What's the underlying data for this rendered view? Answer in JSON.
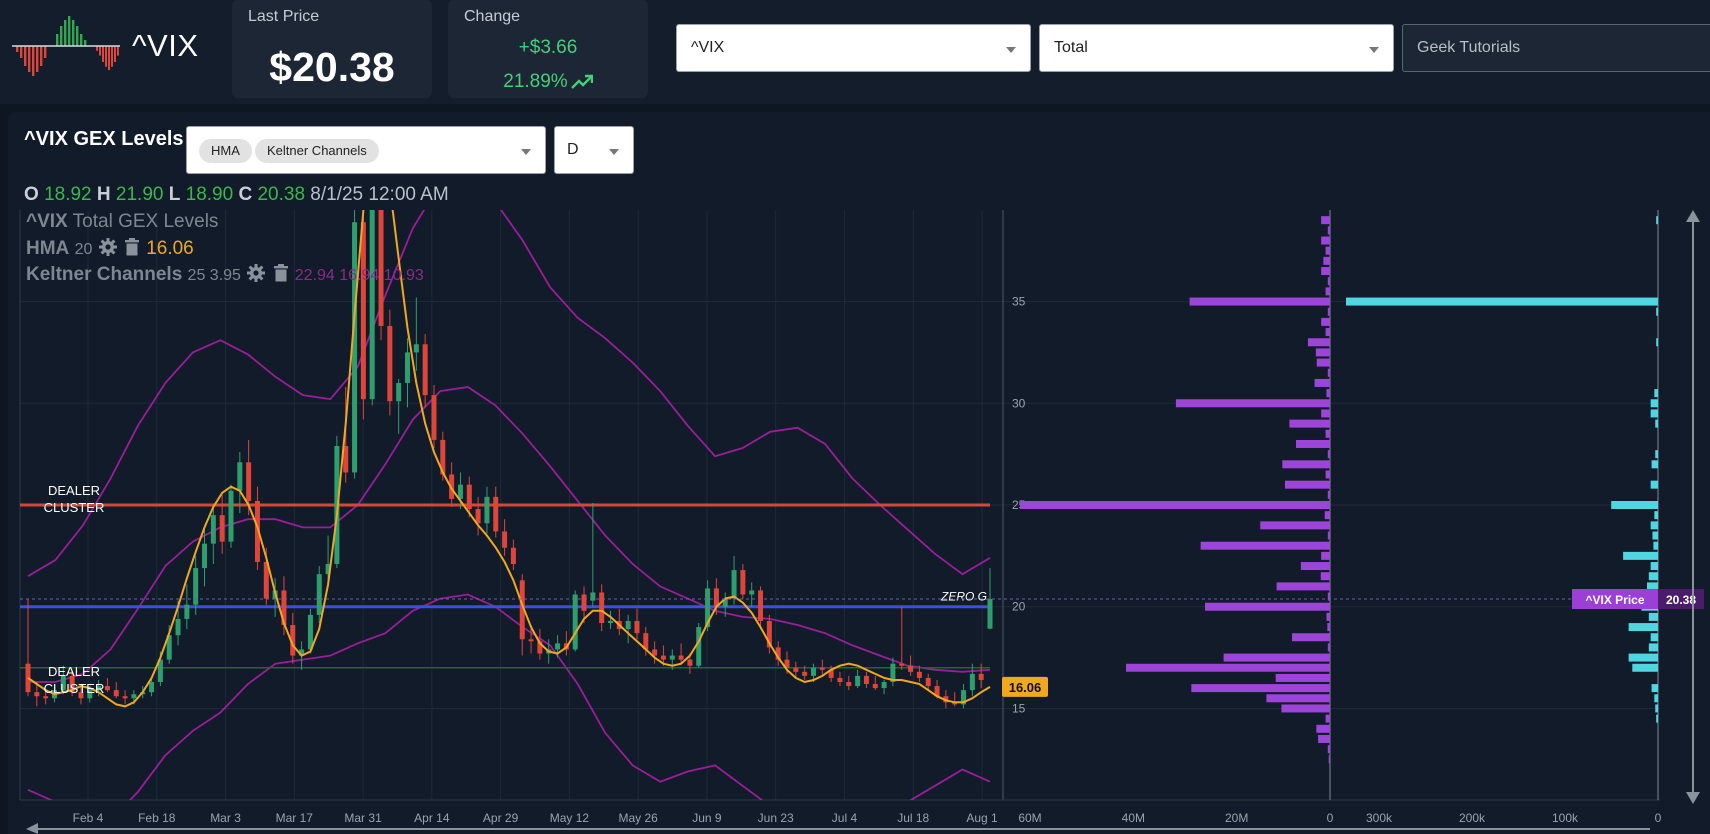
{
  "header": {
    "symbol": "^VIX",
    "last_price_label": "Last Price",
    "last_price": "$20.38",
    "change_label": "Change",
    "change_abs": "+$3.66",
    "change_pct": "21.89%",
    "symbol_select": "^VIX",
    "type_select": "Total",
    "tutorial_select": "Geek Tutorials"
  },
  "panel": {
    "title": "^VIX GEX Levels",
    "indicators": [
      "HMA",
      "Keltner Channels"
    ],
    "timeframe": "D"
  },
  "ohlc": {
    "o_label": "O",
    "o": "18.92",
    "h_label": "H",
    "h": "21.90",
    "l_label": "L",
    "l": "18.90",
    "c_label": "C",
    "c": "20.38",
    "datetime": "8/1/25 12:00 AM"
  },
  "legend": {
    "series_symbol": "^VIX",
    "series_name": "Total GEX Levels",
    "hma_name": "HMA",
    "hma_param": "20",
    "hma_value": "16.06",
    "kc_name": "Keltner Channels",
    "kc_param": "25 3.95",
    "kc_values": "22.94 16.94 10.93"
  },
  "colors": {
    "up": "#2e9e6e",
    "down": "#e0453a",
    "hma": "#f0a820",
    "keltner": "#9a1e9a",
    "dealer_line": "#d6473a",
    "zero_g_line": "#3b4fe0",
    "gex_call": "#9c45d8",
    "gex_put": "#4fd6e0",
    "price_badge": "#9c3fd6"
  },
  "chart_data": {
    "type": "candlestick",
    "x_tick_labels": [
      "Feb 4",
      "Feb 18",
      "Mar 3",
      "Mar 17",
      "Mar 31",
      "Apr 14",
      "Apr 29",
      "May 12",
      "May 26",
      "Jun 9",
      "Jun 23",
      "Jul 4",
      "Jul 18",
      "Aug 1"
    ],
    "y_ticks": [
      15,
      20,
      25,
      30,
      35
    ],
    "ylim": [
      10.5,
      39.5
    ],
    "candles": [
      [
        17.2,
        20.4,
        15.6,
        15.8
      ],
      [
        15.8,
        16.3,
        15.1,
        15.6
      ],
      [
        15.6,
        15.9,
        15.2,
        15.5
      ],
      [
        15.5,
        16.2,
        15.3,
        15.9
      ],
      [
        15.9,
        17.1,
        15.7,
        16.6
      ],
      [
        16.6,
        16.9,
        15.6,
        15.8
      ],
      [
        15.8,
        16.1,
        15.2,
        15.5
      ],
      [
        15.5,
        16.1,
        15.3,
        15.9
      ],
      [
        15.9,
        16.4,
        15.6,
        16.1
      ],
      [
        16.1,
        16.5,
        15.8,
        15.9
      ],
      [
        15.9,
        16.3,
        15.5,
        15.6
      ],
      [
        15.6,
        15.9,
        15.2,
        15.5
      ],
      [
        15.5,
        15.9,
        15.2,
        15.7
      ],
      [
        15.7,
        16.1,
        15.5,
        15.8
      ],
      [
        15.8,
        16.5,
        15.6,
        16.3
      ],
      [
        16.3,
        17.8,
        16.1,
        17.4
      ],
      [
        17.4,
        19.1,
        17.2,
        18.6
      ],
      [
        18.6,
        20.3,
        18.1,
        19.4
      ],
      [
        19.4,
        21.1,
        18.9,
        20.1
      ],
      [
        20.1,
        22.5,
        19.6,
        21.9
      ],
      [
        21.9,
        23.8,
        21.0,
        23.1
      ],
      [
        23.1,
        24.9,
        22.1,
        24.5
      ],
      [
        24.5,
        25.5,
        22.6,
        23.2
      ],
      [
        23.2,
        26.0,
        22.9,
        25.7
      ],
      [
        25.7,
        27.6,
        24.6,
        27.1
      ],
      [
        27.1,
        28.2,
        24.5,
        25.2
      ],
      [
        25.2,
        25.9,
        21.8,
        22.2
      ],
      [
        22.2,
        22.9,
        20.1,
        20.4
      ],
      [
        20.4,
        21.4,
        19.5,
        20.8
      ],
      [
        20.8,
        21.5,
        18.6,
        19.1
      ],
      [
        19.1,
        19.7,
        17.2,
        17.6
      ],
      [
        17.6,
        18.3,
        16.9,
        17.9
      ],
      [
        17.9,
        19.9,
        17.7,
        19.6
      ],
      [
        19.6,
        22.0,
        19.2,
        21.6
      ],
      [
        21.6,
        23.5,
        21.0,
        22.1
      ],
      [
        22.1,
        28.4,
        21.9,
        27.9
      ],
      [
        27.9,
        30.8,
        26.1,
        26.6
      ],
      [
        26.6,
        40.0,
        26.3,
        38.9
      ],
      [
        38.9,
        44.5,
        29.2,
        30.2
      ],
      [
        30.2,
        52.3,
        29.9,
        45.3
      ],
      [
        45.3,
        46.1,
        33.1,
        33.8
      ],
      [
        33.8,
        34.6,
        29.4,
        30.1
      ],
      [
        30.1,
        31.2,
        28.5,
        31.0
      ],
      [
        31.0,
        33.2,
        29.8,
        32.5
      ],
      [
        32.5,
        35.2,
        31.6,
        32.9
      ],
      [
        32.9,
        33.4,
        29.8,
        30.4
      ],
      [
        30.4,
        30.9,
        27.8,
        28.2
      ],
      [
        28.2,
        28.6,
        26.2,
        26.5
      ],
      [
        26.5,
        27.1,
        24.9,
        25.3
      ],
      [
        25.3,
        26.6,
        24.8,
        26.0
      ],
      [
        26.0,
        26.4,
        24.4,
        24.8
      ],
      [
        24.8,
        25.4,
        23.5,
        24.1
      ],
      [
        24.1,
        25.9,
        23.6,
        25.4
      ],
      [
        25.4,
        25.9,
        23.4,
        23.7
      ],
      [
        23.7,
        24.3,
        22.5,
        22.9
      ],
      [
        22.9,
        23.3,
        21.8,
        22.1
      ],
      [
        21.3,
        21.6,
        17.6,
        18.4
      ],
      [
        18.4,
        19.1,
        17.7,
        18.3
      ],
      [
        18.3,
        18.9,
        17.4,
        17.7
      ],
      [
        17.7,
        18.4,
        17.2,
        17.9
      ],
      [
        17.9,
        18.6,
        17.5,
        18.2
      ],
      [
        18.2,
        18.8,
        17.6,
        17.9
      ],
      [
        17.9,
        20.8,
        17.8,
        20.6
      ],
      [
        20.6,
        21.0,
        19.2,
        19.8
      ],
      [
        20.3,
        25.1,
        20.0,
        20.7
      ],
      [
        20.7,
        21.1,
        18.8,
        19.2
      ],
      [
        19.2,
        19.8,
        18.9,
        19.3
      ],
      [
        19.3,
        19.9,
        18.6,
        18.9
      ],
      [
        18.9,
        19.6,
        18.2,
        19.3
      ],
      [
        19.3,
        19.9,
        18.4,
        18.7
      ],
      [
        18.7,
        19.0,
        17.6,
        17.9
      ],
      [
        17.9,
        18.3,
        17.2,
        17.6
      ],
      [
        17.6,
        18.1,
        17.1,
        17.4
      ],
      [
        17.4,
        17.9,
        16.9,
        17.6
      ],
      [
        17.6,
        18.2,
        17.2,
        17.4
      ],
      [
        17.4,
        17.7,
        16.7,
        17.1
      ],
      [
        17.1,
        19.2,
        17.0,
        19.0
      ],
      [
        19.0,
        21.3,
        18.8,
        20.9
      ],
      [
        20.9,
        21.4,
        19.6,
        20.0
      ],
      [
        20.0,
        20.7,
        19.5,
        20.4
      ],
      [
        20.4,
        22.5,
        20.1,
        21.8
      ],
      [
        21.8,
        22.1,
        20.4,
        20.6
      ],
      [
        20.6,
        21.2,
        20.0,
        20.8
      ],
      [
        20.8,
        21.0,
        18.9,
        19.3
      ],
      [
        19.3,
        19.6,
        17.7,
        18.0
      ],
      [
        18.0,
        18.3,
        17.1,
        17.4
      ],
      [
        17.4,
        17.8,
        16.7,
        17.0
      ],
      [
        17.0,
        17.3,
        16.5,
        16.8
      ],
      [
        16.8,
        17.1,
        16.4,
        16.6
      ],
      [
        16.6,
        17.2,
        16.3,
        17.0
      ],
      [
        17.0,
        17.4,
        16.6,
        16.9
      ],
      [
        16.9,
        17.1,
        16.3,
        16.5
      ],
      [
        16.5,
        16.8,
        16.1,
        16.3
      ],
      [
        16.3,
        16.6,
        15.9,
        16.1
      ],
      [
        16.1,
        16.9,
        16.0,
        16.6
      ],
      [
        16.6,
        16.8,
        16.0,
        16.2
      ],
      [
        16.2,
        16.6,
        15.9,
        16.0
      ],
      [
        16.0,
        16.4,
        15.7,
        16.3
      ],
      [
        16.3,
        17.5,
        16.1,
        17.2
      ],
      [
        17.2,
        20.0,
        16.9,
        17.1
      ],
      [
        17.1,
        17.6,
        16.6,
        16.8
      ],
      [
        16.8,
        17.1,
        16.3,
        16.5
      ],
      [
        16.5,
        16.7,
        15.9,
        16.1
      ],
      [
        16.1,
        16.4,
        15.5,
        15.6
      ],
      [
        15.6,
        15.9,
        15.0,
        15.3
      ],
      [
        15.3,
        15.8,
        15.1,
        15.2
      ],
      [
        15.2,
        16.2,
        15.0,
        15.9
      ],
      [
        15.9,
        17.2,
        15.6,
        16.7
      ],
      [
        16.7,
        17.2,
        16.0,
        16.4
      ],
      [
        18.92,
        21.9,
        18.9,
        20.38
      ]
    ],
    "hma": [
      16.5,
      16.2,
      15.9,
      15.7,
      15.8,
      15.9,
      16.1,
      16.0,
      15.8,
      15.5,
      15.2,
      15.1,
      15.3,
      15.8,
      16.5,
      17.5,
      18.7,
      20.0,
      21.4,
      22.7,
      23.9,
      24.9,
      25.6,
      25.9,
      25.7,
      25.0,
      23.9,
      22.4,
      20.7,
      19.2,
      18.1,
      17.6,
      17.8,
      18.9,
      21.1,
      24.5,
      29.0,
      34.4,
      39.5,
      42.9,
      43.1,
      40.6,
      37.1,
      33.7,
      31.0,
      29.0,
      27.6,
      26.6,
      25.8,
      25.2,
      24.6,
      24.0,
      23.5,
      22.9,
      22.2,
      21.3,
      20.1,
      19.0,
      18.2,
      17.8,
      17.7,
      18.0,
      18.7,
      19.4,
      19.8,
      19.8,
      19.5,
      19.1,
      18.7,
      18.3,
      17.9,
      17.5,
      17.2,
      17.1,
      17.2,
      17.6,
      18.3,
      19.2,
      20.0,
      20.4,
      20.5,
      20.2,
      19.7,
      19.0,
      18.2,
      17.5,
      16.9,
      16.5,
      16.3,
      16.4,
      16.6,
      16.9,
      17.1,
      17.2,
      17.1,
      16.9,
      16.7,
      16.5,
      16.4,
      16.4,
      16.3,
      16.2,
      15.9,
      15.6,
      15.4,
      15.3,
      15.3,
      15.5,
      15.8,
      16.06
    ],
    "keltner_upper": [
      21.5,
      22.3,
      24.0,
      26.3,
      28.9,
      31.0,
      32.5,
      33.1,
      32.4,
      31.3,
      30.4,
      30.2,
      31.8,
      35.3,
      38.6,
      40.8,
      41.0,
      39.9,
      38.0,
      35.7,
      34.2,
      33.2,
      32.0,
      30.6,
      28.9,
      27.4,
      27.8,
      28.6,
      28.8,
      28.0,
      26.3,
      25.0,
      23.8,
      22.6,
      21.6,
      22.4
    ],
    "keltner_mid": [
      16.3,
      16.3,
      16.7,
      17.9,
      19.9,
      22.0,
      23.2,
      23.9,
      24.3,
      24.3,
      23.9,
      23.9,
      25.0,
      27.0,
      29.2,
      30.6,
      30.8,
      29.9,
      28.5,
      26.9,
      25.2,
      23.5,
      22.1,
      21.0,
      20.4,
      19.8,
      19.5,
      19.4,
      19.1,
      18.7,
      18.1,
      17.6,
      17.1,
      16.9,
      16.8,
      16.9
    ],
    "keltner_lower": [
      11.0,
      10.4,
      9.4,
      9.5,
      10.9,
      12.7,
      13.9,
      14.8,
      16.2,
      17.2,
      17.4,
      17.6,
      18.2,
      18.7,
      19.8,
      20.4,
      20.6,
      20.0,
      19.0,
      18.1,
      16.2,
      13.8,
      12.2,
      11.4,
      11.9,
      12.2,
      11.2,
      10.2,
      9.4,
      9.4,
      10.0,
      10.2,
      10.4,
      11.2,
      12.0,
      11.4
    ],
    "levels": [
      {
        "label": "DEALER CLUSTER",
        "value": 25,
        "color": "#d6473a"
      },
      {
        "label": "ZERO G",
        "value": 20,
        "color": "#3b4fe0"
      },
      {
        "label": "DEALER CLUSTER",
        "value": 17,
        "color": "#1f6a2a"
      }
    ],
    "hma_badge": "16.06",
    "price_badge_label": "^VIX Price",
    "price_badge_value": "20.38",
    "gex_left_ticks": [
      "60M",
      "40M",
      "20M",
      "0"
    ],
    "gex_right_ticks": [
      "300k",
      "200k",
      "100k",
      "0"
    ],
    "gex_levels": [
      39,
      38.5,
      38,
      37.5,
      37,
      36.5,
      36,
      35.5,
      35,
      34.5,
      34,
      33.5,
      33,
      32.5,
      32,
      31.5,
      31,
      30.5,
      30,
      29.5,
      29,
      28.5,
      28,
      27.5,
      27,
      26.5,
      26,
      25.5,
      25,
      24.5,
      24,
      23.5,
      23,
      22.5,
      22,
      21.5,
      21,
      20.5,
      20,
      19.5,
      19,
      18.5,
      18,
      17.5,
      17,
      16.5,
      16,
      15.5,
      15,
      14.5,
      14,
      13.5,
      13,
      12.5
    ],
    "gex_call_millions": [
      2,
      0.5,
      2,
      1,
      1.5,
      2,
      0.5,
      1,
      31.8,
      0.5,
      2,
      1,
      5,
      3.2,
      3,
      0.5,
      3.5,
      0.8,
      34.9,
      2,
      9.2,
      1,
      7.7,
      0.5,
      10.8,
      1,
      10.2,
      0.5,
      70.2,
      1.2,
      15.8,
      0.5,
      29.3,
      2,
      6.6,
      2.1,
      12.1,
      0.5,
      28.3,
      0.8,
      0.6,
      8.6,
      0.5,
      24.1,
      46.2,
      12.3,
      31.4,
      14.4,
      11,
      1,
      3.1,
      2.7,
      0.5,
      0.3
    ],
    "gex_put_thousands": [
      0,
      0,
      0,
      0,
      0,
      0,
      0,
      0,
      0,
      0,
      0,
      0,
      0,
      0,
      0,
      0,
      0,
      0,
      0,
      0,
      0,
      0,
      0,
      0,
      0,
      0,
      0,
      0,
      0,
      0,
      0,
      0,
      0,
      0,
      0,
      0,
      0,
      0,
      0,
      0,
      0,
      0,
      0,
      0,
      0,
      0,
      0,
      0,
      0,
      0,
      0,
      0,
      0,
      0
    ],
    "gex_put_bars_thousands": [
      {
        "level": 39,
        "value": 2
      },
      {
        "level": 35,
        "value": 340
      },
      {
        "level": 34.5,
        "value": 2
      },
      {
        "level": 33,
        "value": 2
      },
      {
        "level": 30.5,
        "value": 4
      },
      {
        "level": 30,
        "value": 8
      },
      {
        "level": 29.5,
        "value": 8
      },
      {
        "level": 29,
        "value": 3
      },
      {
        "level": 27.5,
        "value": 3
      },
      {
        "level": 27,
        "value": 7
      },
      {
        "level": 26,
        "value": 8
      },
      {
        "level": 25,
        "value": 51
      },
      {
        "level": 24.5,
        "value": 4
      },
      {
        "level": 24,
        "value": 8
      },
      {
        "level": 23.5,
        "value": 6
      },
      {
        "level": 23,
        "value": 5
      },
      {
        "level": 22.5,
        "value": 38
      },
      {
        "level": 22,
        "value": 8
      },
      {
        "level": 21.5,
        "value": 10
      },
      {
        "level": 21,
        "value": 12
      },
      {
        "level": 20,
        "value": 18
      },
      {
        "level": 19.5,
        "value": 10
      },
      {
        "level": 19,
        "value": 32
      },
      {
        "level": 18.5,
        "value": 8
      },
      {
        "level": 18,
        "value": 10
      },
      {
        "level": 17.5,
        "value": 32
      },
      {
        "level": 17,
        "value": 28
      },
      {
        "level": 16,
        "value": 7
      },
      {
        "level": 15.5,
        "value": 4
      },
      {
        "level": 15,
        "value": 3
      },
      {
        "level": 14.5,
        "value": 2
      }
    ]
  }
}
